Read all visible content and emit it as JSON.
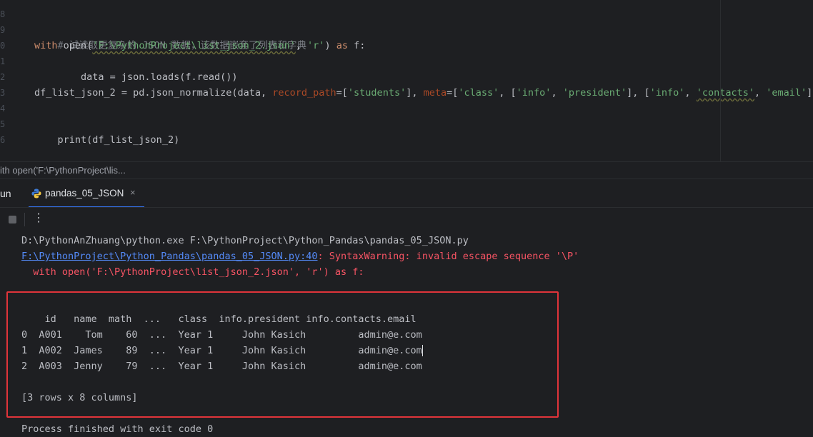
{
  "editor": {
    "line_numbers": [
      "8",
      "9",
      "0",
      "1",
      "2",
      "3",
      "4",
      "5",
      "6"
    ],
    "lines": {
      "comment": "# 试读取更复杂的 JSON 数据，该数据嵌套了列表和字典",
      "with_kw": "with",
      "open_fn": " open(",
      "path_str": "'F:\\PythonProject\\list_json_2.json'",
      "comma1": ", ",
      "mode_str": "'r'",
      "close_paren": ")",
      "as_kw": " as ",
      "f_colon": "f:",
      "data_line": "    data = json.loads(f.read())",
      "df_assign": "df_list_json_2 = pd.json_normalize(data, ",
      "record_path_param": "record_path",
      "eq1": "=[",
      "students_str": "'students'",
      "close1": "], ",
      "meta_param": "meta",
      "eq2": "=[",
      "class_str": "'class'",
      "comma2": ", [",
      "info_str1": "'info'",
      "comma3": ", ",
      "president_str": "'president'",
      "close2": "], [",
      "info_str2": "'info'",
      "comma4": ", ",
      "contacts_str": "'contacts'",
      "comma5": ", ",
      "email_str": "'email'",
      "close3": "]])",
      "print_line": "print(df_list_json_2)"
    }
  },
  "breadcrumb": "ith open('F:\\PythonProject\\lis...",
  "run_panel": {
    "run_label": "un",
    "tab_label": "pandas_05_JSON",
    "tab_close": "×",
    "more_label": "⋮"
  },
  "console": {
    "cmd": "D:\\PythonAnZhuang\\python.exe F:\\PythonProject\\Python_Pandas\\pandas_05_JSON.py",
    "warn_link": "F:\\PythonProject\\Python_Pandas\\pandas_05_JSON.py:40",
    "warn_msg": ": SyntaxWarning: invalid escape sequence '\\P'",
    "warn_src": "  with open('F:\\PythonProject\\list_json_2.json', 'r') as f:",
    "table_header": "    id   name  math  ...   class  info.president info.contacts.email",
    "rows": [
      "0  A001    Tom    60  ...  Year 1     John Kasich         admin@e.com",
      "1  A002  James    89  ...  Year 1     John Kasich         admin@e.com",
      "2  A003  Jenny    79  ...  Year 1     John Kasich         admin@e.com"
    ],
    "summary": "[3 rows x 8 columns]",
    "exit_msg": "Process finished with exit code 0"
  },
  "colors": {
    "background": "#1e1f22",
    "highlight_box": "#e0343a",
    "error_text": "#f75464",
    "link": "#548af7",
    "keyword": "#cf8e6d",
    "string": "#6aab73",
    "tab_accent": "#3574f0"
  }
}
